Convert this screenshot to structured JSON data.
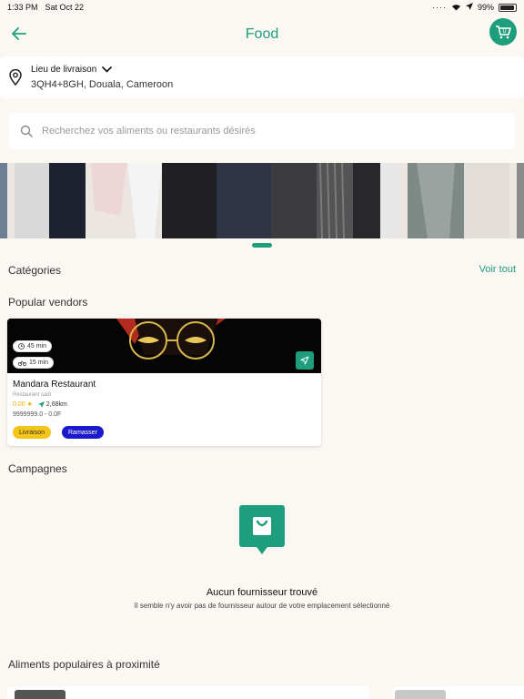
{
  "status": {
    "time": "1:33 PM",
    "date": "Sat Oct 22",
    "battery": "99%"
  },
  "header": {
    "title": "Food"
  },
  "location": {
    "label": "Lieu de livraison",
    "address": "3QH4+8GH, Douala, Cameroon"
  },
  "search": {
    "placeholder": "Recherchez vos aliments ou restaurants désirés"
  },
  "categories": {
    "title": "Catégories",
    "see_all": "Voir tout"
  },
  "popular_vendors": {
    "title": "Popular vendors",
    "vendor": {
      "name": "Mandara Restaurant",
      "subtitle": "Restaurant sadi",
      "rating": "0.00 ★",
      "distance": "2,68km",
      "price": "9999999.0 - 0.0F",
      "time_eta": "45 min",
      "time_ride": "15 min",
      "tags": {
        "delivery": "Livraison",
        "pickup": "Ramasser"
      }
    }
  },
  "campaigns": {
    "title": "Campagnes",
    "empty_title": "Aucun fournisseur trouvé",
    "empty_desc": "Il semble n'y avoir pas de fournisseur autour de votre emplacement sélectionné"
  },
  "popular_food": {
    "title": "Aliments populaires à proximité"
  },
  "colors": {
    "accent": "#1e9e7c",
    "background": "#fbf7f2",
    "livraison": "#f5c518",
    "ramasser": "#1a1acc"
  }
}
